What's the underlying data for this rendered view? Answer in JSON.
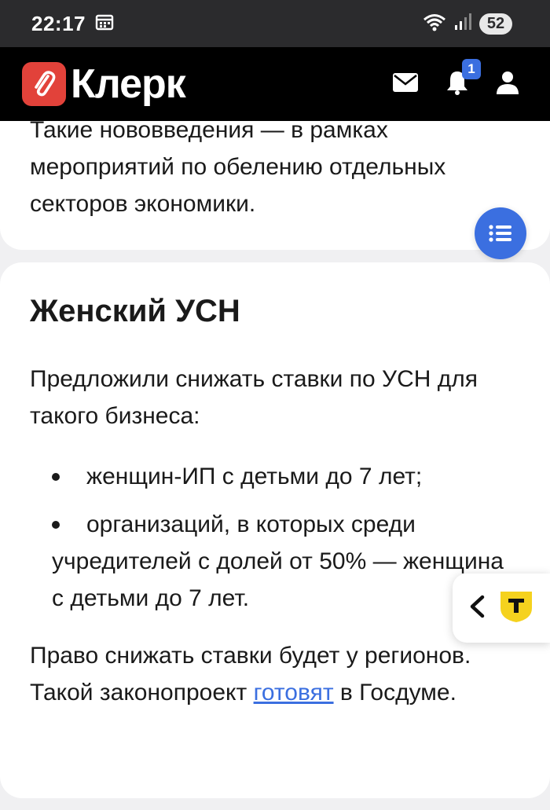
{
  "status_bar": {
    "time": "22:17",
    "battery": "52"
  },
  "header": {
    "logo": "Клерк",
    "notification_count": "1"
  },
  "top_card": {
    "text": "Такие нововведения — в рамках мероприятий по обелению отдельных секторов экономики."
  },
  "article": {
    "title": "Женский УСН",
    "intro": "Предложили снижать ставки по УСН для такого бизнеса:",
    "bullets": [
      "женщин-ИП с детьми до 7 лет;",
      "организаций, в которых среди учредителей с долей от 50% — женщина с детьми до 7 лет."
    ],
    "closing_before_link": "Право снижать ставки будет у регионов. Такой законопроект ",
    "closing_link": "готовят",
    "closing_after_link": " в Госдуме."
  },
  "colors": {
    "accent": "#3b6fe0",
    "brand_red": "#e2423a",
    "badge_yellow": "#f5d21e"
  },
  "icons": [
    "calendar-icon",
    "wifi-icon",
    "signal-icon",
    "paperclip-icon",
    "mail-icon",
    "bell-icon",
    "user-icon",
    "list-icon",
    "chevron-left-icon",
    "t-journal-icon"
  ]
}
